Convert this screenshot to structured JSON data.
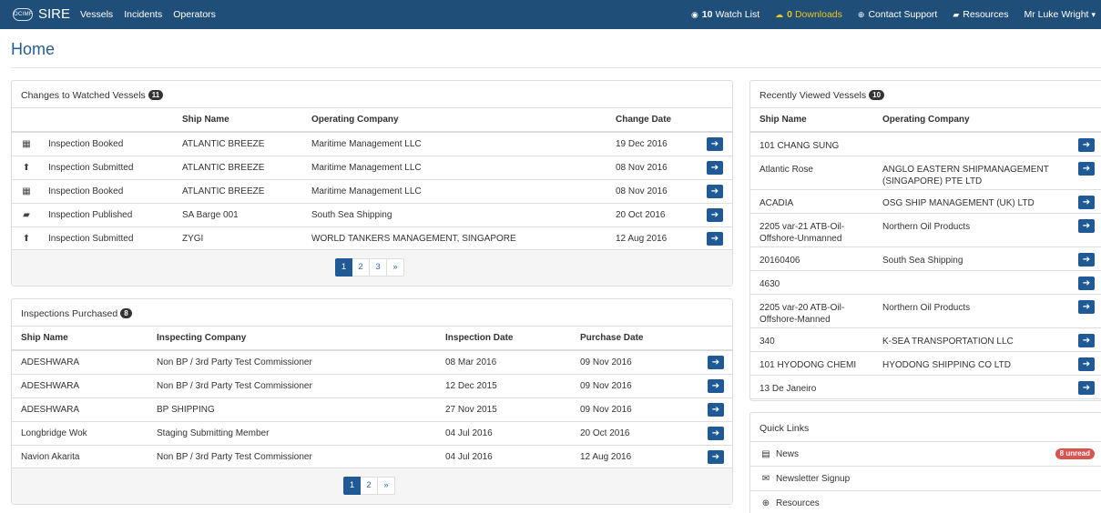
{
  "nav": {
    "logo_text": "OCIMF",
    "brand": "SIRE",
    "links": [
      "Vessels",
      "Incidents",
      "Operators"
    ],
    "watch_count": "10",
    "watch_label": "Watch List",
    "downloads_count": "0",
    "downloads_label": "Downloads",
    "contact_label": "Contact Support",
    "resources_label": "Resources",
    "user_label": "Mr Luke Wright"
  },
  "page": {
    "title": "Home"
  },
  "watched": {
    "title": "Changes to Watched Vessels",
    "count": "11",
    "columns": [
      "Ship Name",
      "Operating Company",
      "Change Date"
    ],
    "rows": [
      {
        "icon": "calendar-icon",
        "glyph": "▦",
        "change": "Inspection Booked",
        "ship": "ATLANTIC BREEZE",
        "company": "Maritime Management LLC",
        "date": "19 Dec 2016"
      },
      {
        "icon": "upload-icon",
        "glyph": "⬆",
        "change": "Inspection Submitted",
        "ship": "ATLANTIC BREEZE",
        "company": "Maritime Management LLC",
        "date": "08 Nov 2016"
      },
      {
        "icon": "calendar-icon",
        "glyph": "▦",
        "change": "Inspection Booked",
        "ship": "ATLANTIC BREEZE",
        "company": "Maritime Management LLC",
        "date": "08 Nov 2016"
      },
      {
        "icon": "book-icon",
        "glyph": "▰",
        "change": "Inspection Published",
        "ship": "SA Barge 001",
        "company": "South Sea Shipping",
        "date": "20 Oct 2016"
      },
      {
        "icon": "upload-icon",
        "glyph": "⬆",
        "change": "Inspection Submitted",
        "ship": "ZYGI",
        "company": "WORLD TANKERS MANAGEMENT, SINGAPORE",
        "date": "12 Aug 2016"
      }
    ],
    "pages": [
      "1",
      "2",
      "3",
      "»"
    ]
  },
  "purchased": {
    "title": "Inspections Purchased",
    "count": "8",
    "columns": [
      "Ship Name",
      "Inspecting Company",
      "Inspection Date",
      "Purchase Date"
    ],
    "rows": [
      {
        "ship": "ADESHWARA",
        "company": "Non BP / 3rd Party Test Commissioner",
        "inspection": "08 Mar 2016",
        "purchase": "09 Nov 2016"
      },
      {
        "ship": "ADESHWARA",
        "company": "Non BP / 3rd Party Test Commissioner",
        "inspection": "12 Dec 2015",
        "purchase": "09 Nov 2016"
      },
      {
        "ship": "ADESHWARA",
        "company": "BP SHIPPING",
        "inspection": "27 Nov 2015",
        "purchase": "09 Nov 2016"
      },
      {
        "ship": "Longbridge Wok",
        "company": "Staging Submitting Member",
        "inspection": "04 Jul 2016",
        "purchase": "20 Oct 2016"
      },
      {
        "ship": "Navion Akarita",
        "company": "Non BP / 3rd Party Test Commissioner",
        "inspection": "04 Jul 2016",
        "purchase": "12 Aug 2016"
      }
    ],
    "pages": [
      "1",
      "2",
      "»"
    ]
  },
  "recent": {
    "title": "Recently Viewed Vessels",
    "count": "10",
    "columns": [
      "Ship Name",
      "Operating Company"
    ],
    "rows": [
      {
        "ship": "101 CHANG SUNG",
        "company": ""
      },
      {
        "ship": "Atlantic Rose",
        "company": "ANGLO EASTERN SHIPMANAGEMENT (SINGAPORE) PTE LTD"
      },
      {
        "ship": "ACADIA",
        "company": "OSG SHIP MANAGEMENT (UK) LTD"
      },
      {
        "ship": "2205 var-21 ATB-Oil-Offshore-Unmanned",
        "company": "Northern Oil Products"
      },
      {
        "ship": "20160406",
        "company": "South Sea Shipping"
      },
      {
        "ship": "4630",
        "company": ""
      },
      {
        "ship": "2205 var-20 ATB-Oil-Offshore-Manned",
        "company": "Northern Oil Products"
      },
      {
        "ship": "340",
        "company": "K-SEA TRANSPORTATION LLC"
      },
      {
        "ship": "101 HYODONG CHEMI",
        "company": "HYODONG SHIPPING CO LTD"
      },
      {
        "ship": "13 De Janeiro",
        "company": ""
      }
    ]
  },
  "quick_links": {
    "title": "Quick Links",
    "items": [
      {
        "icon": "newspaper-icon",
        "glyph": "▤",
        "label": "News",
        "badge": "8 unread"
      },
      {
        "icon": "envelope-icon",
        "glyph": "✉",
        "label": "Newsletter Signup",
        "badge": ""
      },
      {
        "icon": "lifebuoy-icon",
        "glyph": "⊕",
        "label": "Resources",
        "badge": ""
      }
    ]
  },
  "colors": {
    "navbar": "#1f4e79",
    "accent": "#1f5a96",
    "downloads": "#f0c419",
    "unread": "#d9534f"
  }
}
